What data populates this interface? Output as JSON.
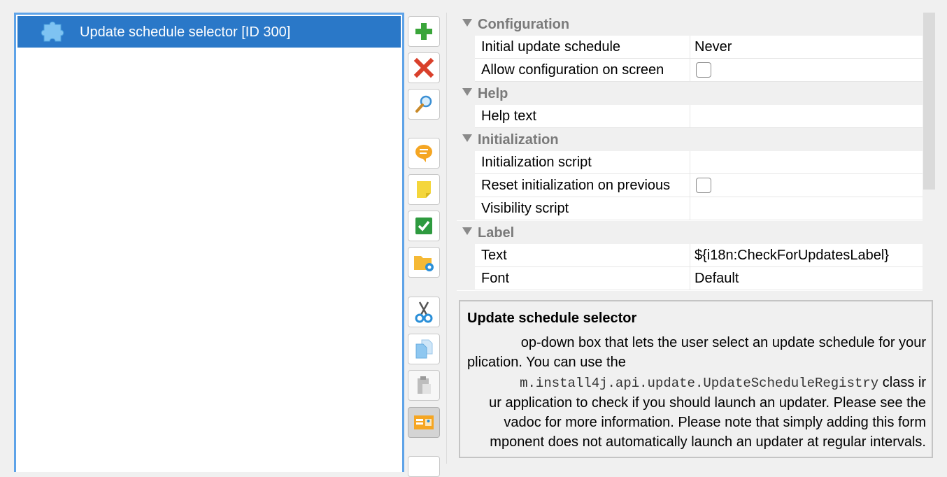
{
  "list": {
    "items": [
      {
        "label": "Update schedule selector [ID 300]",
        "icon": "puzzle-piece-icon"
      }
    ]
  },
  "toolbar": {
    "buttons": [
      {
        "name": "add-button",
        "icon": "plus-icon"
      },
      {
        "name": "delete-button",
        "icon": "x-icon"
      },
      {
        "name": "search-button",
        "icon": "magnifier-icon"
      },
      {
        "name": "comment-button",
        "icon": "speech-bubble-icon"
      },
      {
        "name": "note-button",
        "icon": "sticky-note-icon"
      },
      {
        "name": "check-button",
        "icon": "checkmark-icon"
      },
      {
        "name": "folder-button",
        "icon": "folder-gear-icon"
      },
      {
        "name": "cut-button",
        "icon": "scissors-icon"
      },
      {
        "name": "copy-button",
        "icon": "copy-icon"
      },
      {
        "name": "paste-button",
        "icon": "clipboard-icon"
      },
      {
        "name": "screen-button",
        "icon": "form-preview-icon"
      }
    ]
  },
  "properties": {
    "categories": [
      {
        "label": "Configuration",
        "rows": [
          {
            "name": "Initial update schedule",
            "value": "Never"
          },
          {
            "name": "Allow configuration on screen",
            "checked": false
          }
        ]
      },
      {
        "label": "Help",
        "rows": [
          {
            "name": "Help text",
            "value": ""
          }
        ]
      },
      {
        "label": "Initialization",
        "rows": [
          {
            "name": "Initialization script",
            "value": ""
          },
          {
            "name": "Reset initialization on previous",
            "checked": false
          },
          {
            "name": "Visibility script",
            "value": ""
          }
        ]
      },
      {
        "label": "Label",
        "rows": [
          {
            "name": "Text",
            "value": "${i18n:CheckForUpdatesLabel}"
          },
          {
            "name": "Font",
            "value": "Default"
          }
        ]
      }
    ]
  },
  "description": {
    "title": "Update schedule selector",
    "line1": "op-down box that lets the user select an update schedule for your",
    "line2": "plication. You can use the",
    "line3_code": "m.install4j.api.update.UpdateScheduleRegistry",
    "line3_rest": " class ir",
    "line4": "ur application to check if you should launch an updater. Please see the",
    "line5": "vadoc for more information. Please note that simply adding this form",
    "line6": "mponent does not automatically launch an updater at regular intervals."
  },
  "colors": {
    "selection": "#2a78c8",
    "list_border": "#5ea3e8",
    "category_text": "#7a7a7a"
  }
}
